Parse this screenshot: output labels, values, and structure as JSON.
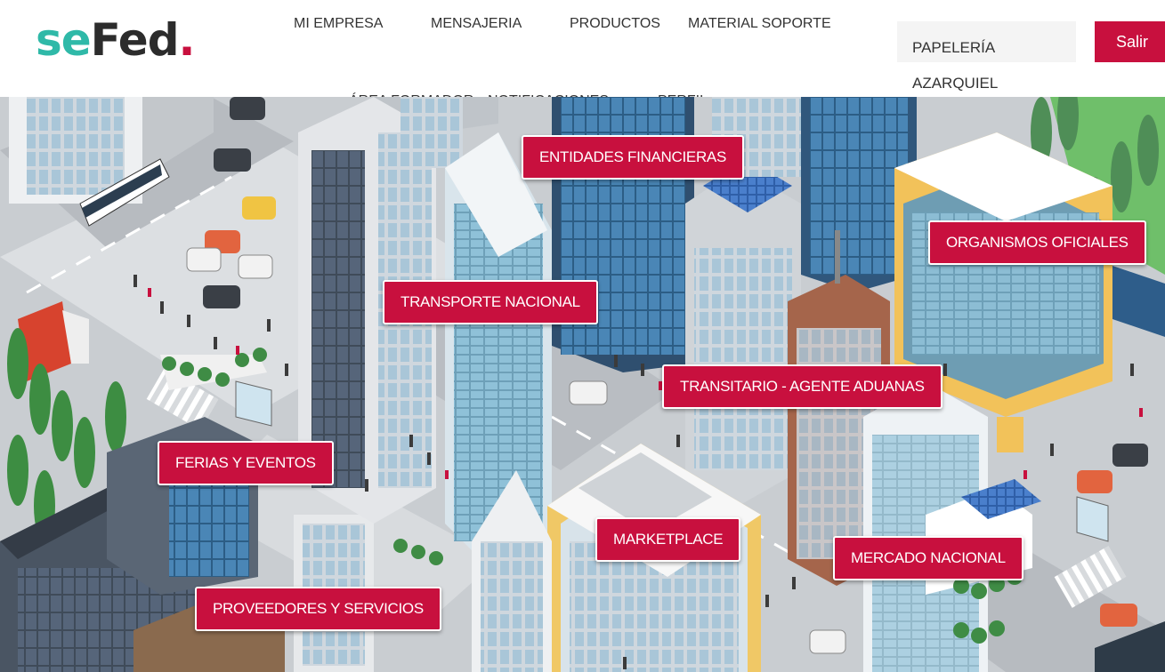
{
  "logo": {
    "part1": "se",
    "part2": "Fed",
    "dot": "."
  },
  "nav": {
    "top": [
      "MI EMPRESA",
      "MENSAJERIA",
      "PRODUCTOS",
      "MATERIAL SOPORTE"
    ],
    "second": [
      "ÁREA FORMADOR",
      "NOTIFICACIONES",
      "PERFIL"
    ]
  },
  "user": {
    "name": "PAPELERÍA AZARQUIEL"
  },
  "logout_label": "Salir",
  "map_labels": {
    "entidades": "ENTIDADES FINANCIERAS",
    "organismos": "ORGANISMOS OFICIALES",
    "transporte": "TRANSPORTE NACIONAL",
    "transitario": "TRANSITARIO - AGENTE ADUANAS",
    "ferias": "FERIAS Y EVENTOS",
    "marketplace": "MARKETPLACE",
    "mercado": "MERCADO NACIONAL",
    "proveedores": "PROVEEDORES Y SERVICIOS"
  },
  "colors": {
    "accent": "#c8103e",
    "logo_teal": "#2fb9a8"
  }
}
